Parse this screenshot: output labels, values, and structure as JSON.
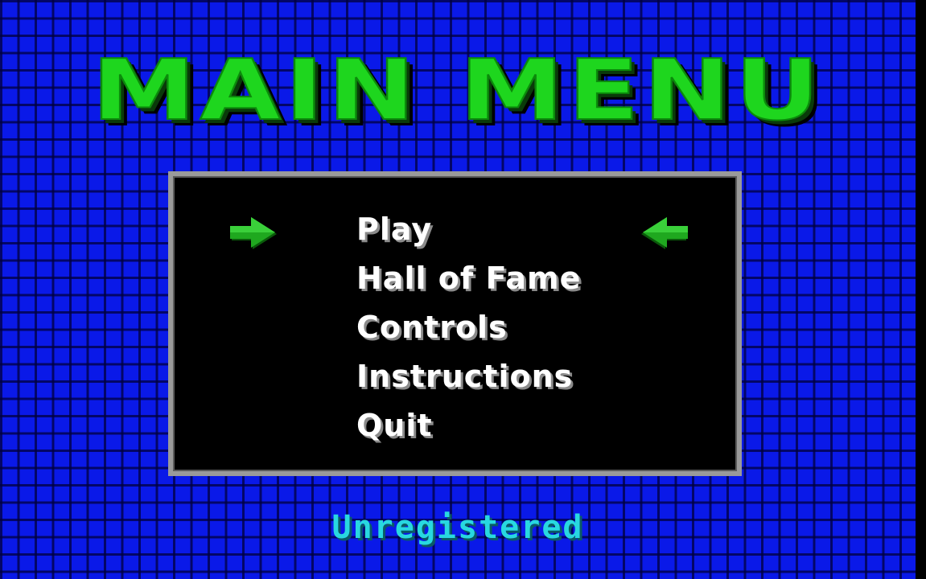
{
  "screen": {
    "title": "MAIN MENU",
    "status": "Unregistered"
  },
  "menu": {
    "items": [
      {
        "label": "Play",
        "selected": true
      },
      {
        "label": "Hall of Fame",
        "selected": false
      },
      {
        "label": "Controls",
        "selected": false
      },
      {
        "label": "Instructions",
        "selected": false
      },
      {
        "label": "Quit",
        "selected": false
      }
    ],
    "selector_icons": [
      "arrow-right-icon",
      "arrow-left-icon"
    ]
  },
  "colors": {
    "background": "#0a19e8",
    "title": "#1ed61e",
    "menu_text": "#ffffff",
    "status": "#28d8e0",
    "box_border": "#9a9a9a"
  }
}
